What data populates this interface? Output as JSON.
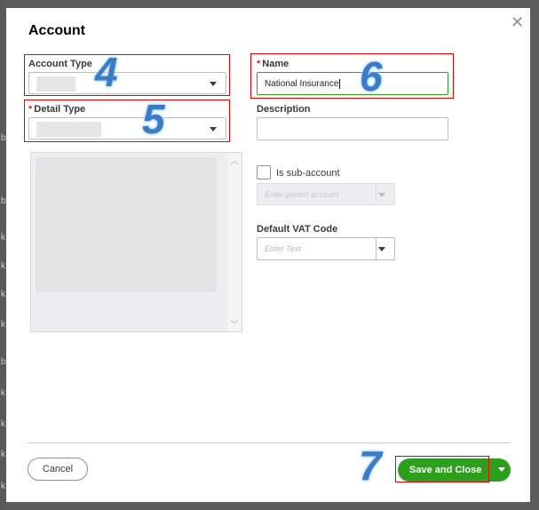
{
  "background": {
    "letters": [
      "b",
      "b",
      "k",
      "k",
      "k",
      "k",
      "b",
      "k",
      "k",
      "k",
      "k"
    ]
  },
  "modal": {
    "title": "Account",
    "close_icon": "close-icon",
    "account_type": {
      "label": "Account Type",
      "value": ""
    },
    "detail_type": {
      "label": "Detail Type",
      "required": "*",
      "value": ""
    },
    "name": {
      "label": "Name",
      "required": "*",
      "value": "National Insurance"
    },
    "description": {
      "label": "Description",
      "value": ""
    },
    "sub_account": {
      "label": "Is sub-account",
      "checked": false,
      "placeholder": "Enter parent account"
    },
    "vat_code": {
      "label": "Default VAT Code",
      "placeholder": "Enter Text"
    },
    "cancel_label": "Cancel",
    "save_label": "Save and Close"
  },
  "annotations": {
    "n4": "4",
    "n5": "5",
    "n6": "6",
    "n7": "7"
  },
  "colors": {
    "accent": "#2ca01c",
    "highlight": "#ff0000"
  }
}
